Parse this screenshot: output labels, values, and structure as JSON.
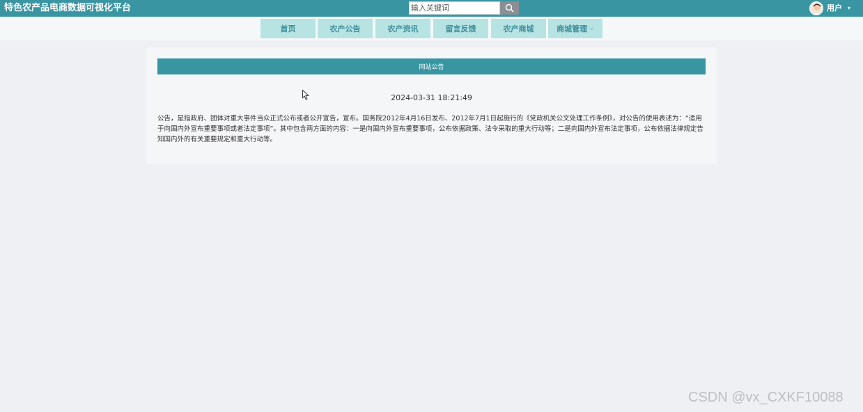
{
  "header": {
    "site_title": "特色农产品电商数据可视化平台",
    "search_placeholder": "输入关键词",
    "search_icon": "search-icon",
    "user_label": "用户",
    "user_caret": "▾"
  },
  "nav": {
    "items": [
      {
        "label": "首页"
      },
      {
        "label": "农产公告"
      },
      {
        "label": "农产资讯"
      },
      {
        "label": "留言反馈"
      },
      {
        "label": "农产商城"
      },
      {
        "label": "商城管理",
        "chevron": "⌵"
      }
    ]
  },
  "notice": {
    "header": "网站公告",
    "date": "2024-03-31 18:21:49",
    "content": "公告，是指政府、团体对重大事件当众正式公布或者公开宣告，宣布。国务院2012年4月16日发布、2012年7月1日起施行的《党政机关公文处理工作条例》，对公告的使用表述为：“适用于向国内外宣布重要事项或者法定事项”。其中包含两方面的内容：一是向国内外宣布重要事项，公布依据政策、法令采取的重大行动等；二是向国内外宣布法定事项，公布依据法律规定告知国内外的有关重要规定和重大行动等。"
  },
  "watermark": "CSDN @vx_CXKF10088",
  "colors": {
    "topbar": "#3a95a2",
    "nav_item_bg": "#b8e3e3",
    "nav_item_text": "#3d8f9a",
    "page_bg": "#eff0f4"
  }
}
